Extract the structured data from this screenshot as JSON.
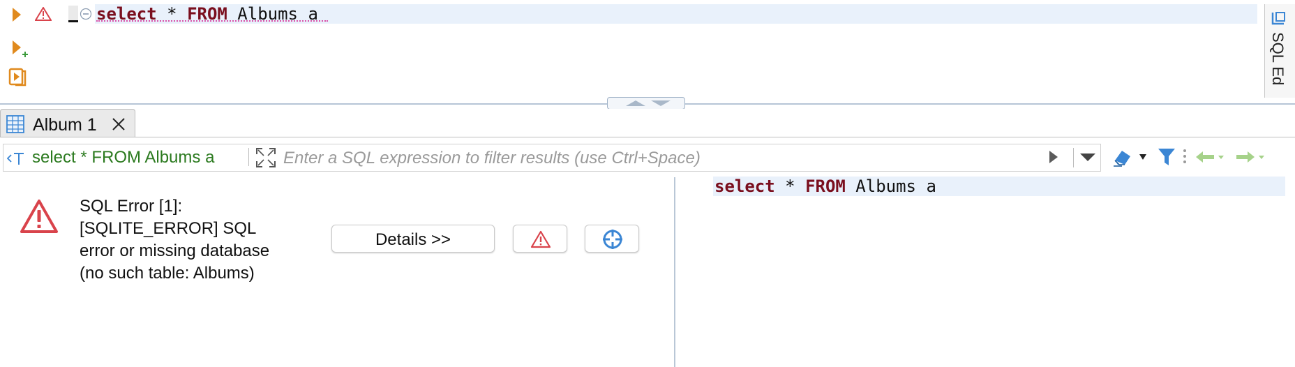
{
  "editor": {
    "code": [
      {
        "text": "select",
        "kind": "keyword"
      },
      {
        "text": " * ",
        "kind": "plain"
      },
      {
        "text": "FROM",
        "kind": "keyword"
      },
      {
        "text": " Albums a",
        "kind": "plain"
      }
    ],
    "gutter_icons": [
      "execute-statement-icon",
      "error-marker-icon",
      "execute-new-tab-icon",
      "execute-script-icon",
      "collapse-fold-icon"
    ],
    "side_panel_label": "SQL Ed"
  },
  "results": {
    "tab_label": "Album 1",
    "filter": {
      "query_text": "select * FROM Albums a",
      "placeholder": "Enter a SQL expression to filter results (use Ctrl+Space)"
    },
    "error": {
      "lines": [
        "SQL Error [1]:",
        "[SQLITE_ERROR] SQL",
        "error or missing database",
        "(no such table: Albums)"
      ],
      "details_button": "Details >>"
    },
    "query_preview": [
      {
        "text": "select",
        "kind": "keyword"
      },
      {
        "text": " * ",
        "kind": "plain"
      },
      {
        "text": "FROM",
        "kind": "keyword"
      },
      {
        "text": " Albums a",
        "kind": "plain"
      }
    ]
  },
  "colors": {
    "keyword": "#7a0f1e",
    "accent_orange": "#e08a1e",
    "error_red": "#d9434b",
    "filter_green": "#2b7a1f",
    "nav_green": "#a6d28a",
    "blue_icon": "#3b86d4",
    "line_highlight": "#e9f1fb"
  }
}
